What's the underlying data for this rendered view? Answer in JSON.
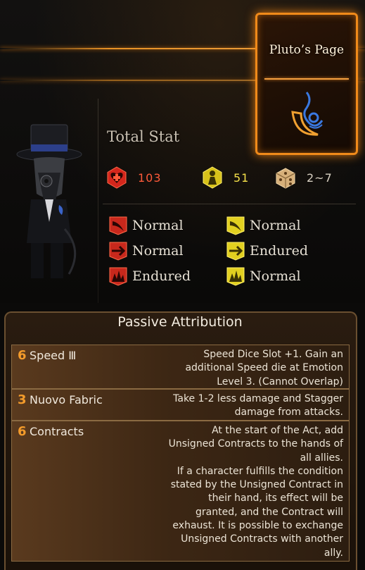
{
  "page_card": {
    "title": "Pluto’s Page",
    "emblem_icon": "crescent-moon-icon"
  },
  "total_stat": {
    "label": "Total Stat",
    "hp": "103",
    "stagger": "51",
    "speed": "2~7"
  },
  "resistances": {
    "hp": [
      {
        "icon": "slash-resist-icon",
        "label": "Normal"
      },
      {
        "icon": "pierce-resist-icon",
        "label": "Normal"
      },
      {
        "icon": "blunt-resist-icon",
        "label": "Endured"
      }
    ],
    "stagger": [
      {
        "icon": "slash-stagger-icon",
        "label": "Normal"
      },
      {
        "icon": "pierce-stagger-icon",
        "label": "Endured"
      },
      {
        "icon": "blunt-stagger-icon",
        "label": "Normal"
      }
    ]
  },
  "passive": {
    "title": "Passive Attribution",
    "items": [
      {
        "cost": "6",
        "name": "Speed Ⅲ",
        "desc": "Speed Dice Slot +1. Gain an\nadditional Speed die at Emotion\nLevel 3. (Cannot Overlap)"
      },
      {
        "cost": "3",
        "name": "Nuovo Fabric",
        "desc": "Take 1-2 less damage and Stagger\ndamage from attacks."
      },
      {
        "cost": "6",
        "name": "Contracts",
        "desc": "At the start of the Act, add\nUnsigned Contracts to the hands of\nall allies.\nIf a character fulfills the condition\nstated by the Unsigned Contract in\ntheir hand, its effect will be\ngranted, and the Contract will\nexhaust. It is possible to exchange\nUnsigned Contracts with another\nally."
      }
    ]
  },
  "colors": {
    "accent": "#f08a1a",
    "hp": "#e8352a",
    "stagger": "#f1df2c",
    "cost": "#f39b2b"
  }
}
